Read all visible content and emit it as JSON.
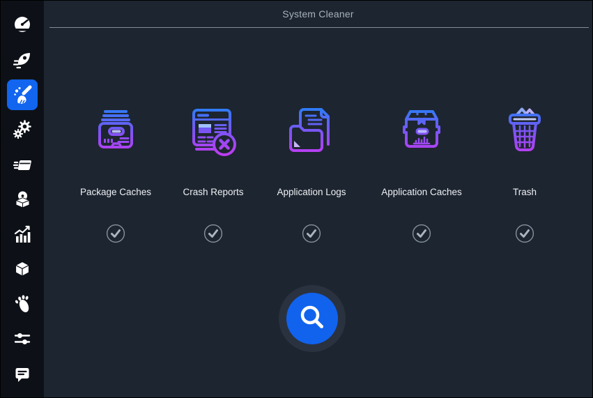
{
  "app": {
    "title": "System Cleaner"
  },
  "colors": {
    "accent_blue": "#1165ef",
    "sidebar_bg": "#0d1117",
    "content_bg": "#1d2530",
    "icon_gradient_top": "#2e7cf6",
    "icon_gradient_bottom": "#bb3df2",
    "title_text": "#a6b2bd",
    "label_text": "#eef1f4",
    "check_gray": "#8a95a3"
  },
  "sidebar": {
    "items": [
      {
        "icon": "speedometer-icon",
        "active": false
      },
      {
        "icon": "rocket-icon",
        "active": false
      },
      {
        "icon": "broom-icon",
        "active": true
      },
      {
        "icon": "gears-icon",
        "active": false
      },
      {
        "icon": "stacked-window-icon",
        "active": false
      },
      {
        "icon": "package-disc-icon",
        "active": false
      },
      {
        "icon": "bar-chart-icon",
        "active": false
      },
      {
        "icon": "cube-box-icon",
        "active": false
      },
      {
        "icon": "gnome-foot-icon",
        "active": false
      },
      {
        "icon": "sliders-icon",
        "active": false
      },
      {
        "icon": "message-icon",
        "active": false
      }
    ]
  },
  "cleaner": {
    "categories": [
      {
        "label": "Package Caches",
        "icon": "package-caches-icon",
        "checked": false
      },
      {
        "label": "Crash Reports",
        "icon": "crash-reports-icon",
        "checked": false
      },
      {
        "label": "Application Logs",
        "icon": "application-logs-icon",
        "checked": false
      },
      {
        "label": "Application Caches",
        "icon": "application-caches-icon",
        "checked": false
      },
      {
        "label": "Trash",
        "icon": "trash-icon",
        "checked": false
      }
    ],
    "scan_button": {
      "icon": "magnifier-icon"
    }
  }
}
